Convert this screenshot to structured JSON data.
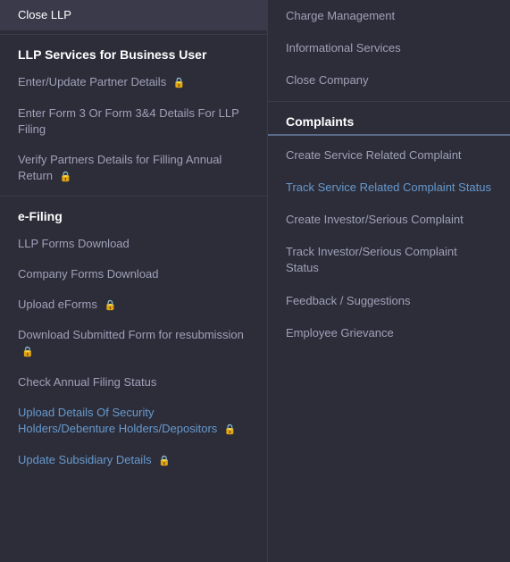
{
  "left": {
    "top_item": {
      "label": "Close LLP"
    },
    "section1": {
      "header": "LLP Services for Business User",
      "items": [
        {
          "label": "Enter/Update Partner Details",
          "lock": true,
          "active": false
        },
        {
          "label": "Enter Form 3 Or Form 3&4 Details For LLP Filing",
          "lock": false,
          "active": false
        },
        {
          "label": "Verify Partners Details for Filling Annual Return",
          "lock": true,
          "active": false
        }
      ]
    },
    "section2": {
      "header": "e-Filing",
      "items": [
        {
          "label": "LLP Forms Download",
          "lock": false,
          "active": false
        },
        {
          "label": "Company Forms Download",
          "lock": false,
          "active": false
        },
        {
          "label": "Upload eForms",
          "lock": true,
          "active": false
        },
        {
          "label": "Download Submitted Form for resubmission",
          "lock": true,
          "active": false
        },
        {
          "label": "Check Annual Filing Status",
          "lock": false,
          "active": false
        },
        {
          "label": "Upload Details Of Security Holders/Debenture Holders/Depositors",
          "lock": true,
          "active": true
        },
        {
          "label": "Update Subsidiary Details",
          "lock": true,
          "active": true
        }
      ]
    }
  },
  "right": {
    "top_items": [
      {
        "label": "Charge Management"
      },
      {
        "label": "Informational Services"
      },
      {
        "label": "Close Company"
      }
    ],
    "section1": {
      "header": "Complaints",
      "items": [
        {
          "label": "Create Service Related Complaint"
        },
        {
          "label": "Track Service Related Complaint Status",
          "active": true
        },
        {
          "label": "Create Investor/Serious Complaint"
        },
        {
          "label": "Track Investor/Serious Complaint Status"
        },
        {
          "label": "Feedback / Suggestions"
        },
        {
          "label": "Employee Grievance"
        }
      ]
    }
  },
  "icons": {
    "lock": "🔒"
  }
}
